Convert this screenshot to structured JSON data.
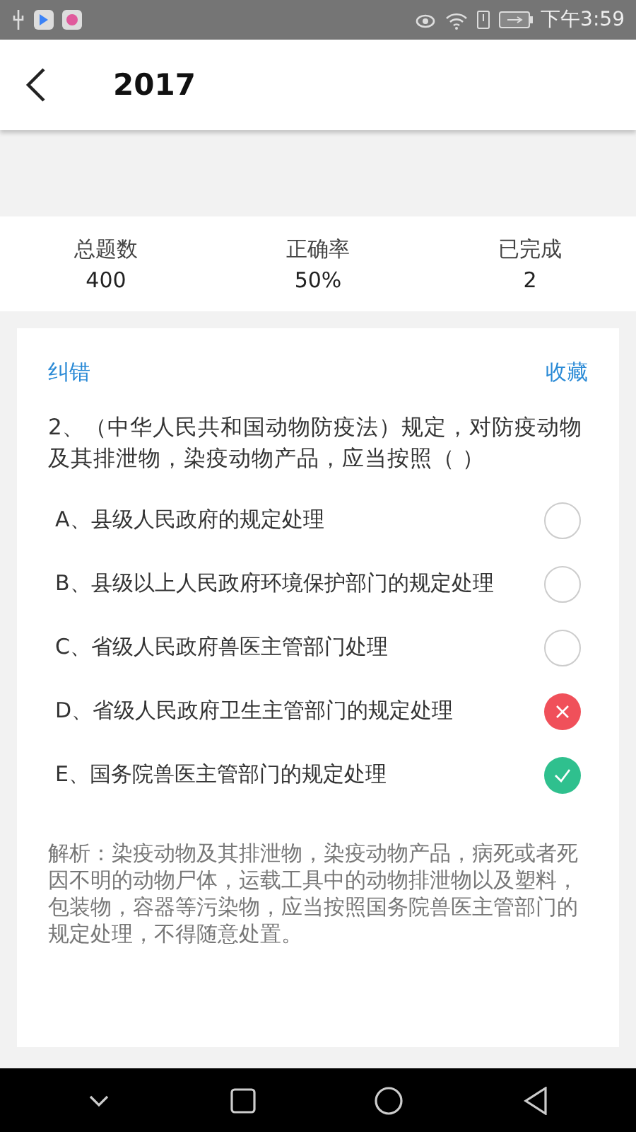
{
  "status_bar": {
    "time": "下午3:59"
  },
  "header": {
    "title": "2017"
  },
  "stats": [
    {
      "label": "总题数",
      "value": "400"
    },
    {
      "label": "正确率",
      "value": "50%"
    },
    {
      "label": "已完成",
      "value": "2"
    }
  ],
  "card": {
    "report_link": "纠错",
    "favorite_link": "收藏",
    "question": "2、（中华人民共和国动物防疫法）规定，对防疫动物及其排泄物，染疫动物产品，应当按照（ ）",
    "options": [
      {
        "text": "A、县级人民政府的规定处理",
        "selected": false,
        "correct": false
      },
      {
        "text": "B、县级以上人民政府环境保护部门的规定处理",
        "selected": false,
        "correct": false
      },
      {
        "text": "C、省级人民政府兽医主管部门处理",
        "selected": false,
        "correct": false
      },
      {
        "text": "D、省级人民政府卫生主管部门的规定处理",
        "selected": true,
        "correct": false
      },
      {
        "text": "E、国务院兽医主管部门的规定处理",
        "selected": false,
        "correct": true
      }
    ],
    "explanation": "解析：染疫动物及其排泄物，染疫动物产品，病死或者死因不明的动物尸体，运载工具中的动物排泄物以及塑料，包装物，容器等污染物，应当按照国务院兽医主管部门的规定处理，不得随意处置。"
  }
}
